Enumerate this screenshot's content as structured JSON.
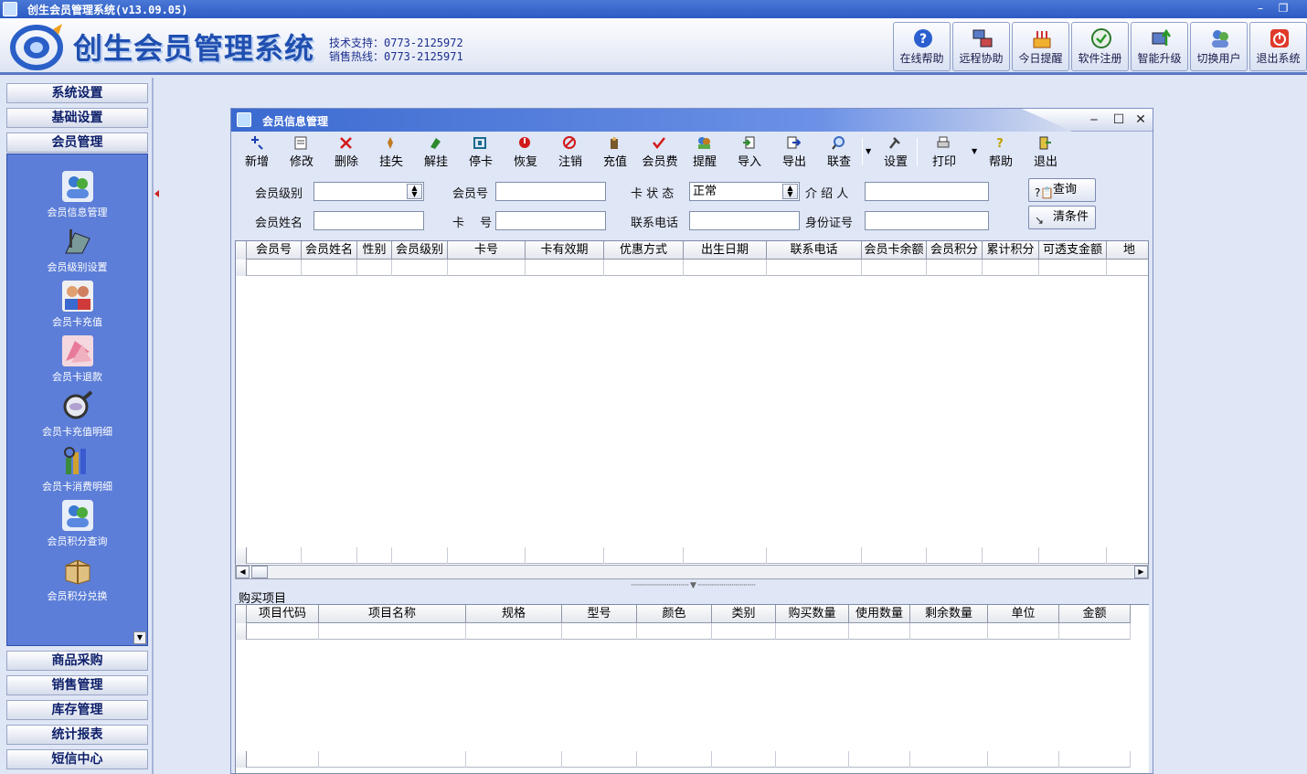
{
  "window": {
    "title": "创生会员管理系统(v13.09.05)",
    "min": "–",
    "restore": "❐",
    "close": "✕"
  },
  "header": {
    "brand": "创生会员管理系统",
    "support": "技术支持：0773-2125972",
    "hotline": "销售热线：0773-2125971",
    "buttons": [
      {
        "label": "在线帮助",
        "icon": "help-icon"
      },
      {
        "label": "远程协助",
        "icon": "remote-icon"
      },
      {
        "label": "今日提醒",
        "icon": "cake-icon"
      },
      {
        "label": "软件注册",
        "icon": "register-icon"
      },
      {
        "label": "智能升级",
        "icon": "upgrade-icon"
      },
      {
        "label": "切换用户",
        "icon": "user-switch-icon"
      },
      {
        "label": "退出系统",
        "icon": "power-icon"
      }
    ]
  },
  "sidebar": {
    "top_groups": [
      "系统设置",
      "基础设置",
      "会员管理"
    ],
    "items": [
      {
        "label": "会员信息管理",
        "icon": "members-icon"
      },
      {
        "label": "会员级别设置",
        "icon": "level-settings-icon"
      },
      {
        "label": "会员卡充值",
        "icon": "recharge-icon"
      },
      {
        "label": "会员卡退款",
        "icon": "refund-icon"
      },
      {
        "label": "会员卡充值明细",
        "icon": "magnifier-icon"
      },
      {
        "label": "会员卡消费明细",
        "icon": "consumption-icon"
      },
      {
        "label": "会员积分查询",
        "icon": "points-query-icon"
      },
      {
        "label": "会员积分兑换",
        "icon": "gift-box-icon"
      }
    ],
    "bottom_groups": [
      "商品采购",
      "销售管理",
      "库存管理",
      "统计报表",
      "短信中心"
    ]
  },
  "child": {
    "title": "会员信息管理",
    "toolbar": [
      {
        "label": "新增",
        "icon": "add-icon",
        "color": "#1a3fb0"
      },
      {
        "label": "修改",
        "icon": "edit-icon",
        "color": "#444444"
      },
      {
        "label": "删除",
        "icon": "delete-icon",
        "color": "#d21818"
      },
      {
        "label": "挂失",
        "icon": "report-loss-icon",
        "color": "#c07a20"
      },
      {
        "label": "解挂",
        "icon": "unlock-icon",
        "color": "#2c8a2c"
      },
      {
        "label": "停卡",
        "icon": "stop-card-icon",
        "color": "#1a6a8a"
      },
      {
        "label": "恢复",
        "icon": "restore-icon",
        "color": "#d21818"
      },
      {
        "label": "注销",
        "icon": "cancel-icon",
        "color": "#d21818"
      },
      {
        "label": "充值",
        "icon": "charge-icon",
        "color": "#7a5a2a"
      },
      {
        "label": "会员费",
        "icon": "check-icon",
        "color": "#d21818"
      },
      {
        "label": "提醒",
        "icon": "remind-icon",
        "color": "#c07a20"
      },
      {
        "label": "导入",
        "icon": "import-icon",
        "color": "#2c8a2c"
      },
      {
        "label": "导出",
        "icon": "export-icon",
        "color": "#1a3fb0"
      },
      {
        "label": "联查",
        "icon": "search-icon",
        "color": "#3a6ac0"
      },
      {
        "label": "设置",
        "icon": "settings-icon",
        "color": "#444444"
      },
      {
        "label": "打印",
        "icon": "print-icon",
        "color": "#444444"
      },
      {
        "label": "帮助",
        "icon": "help-icon",
        "color": "#c0a000"
      },
      {
        "label": "退出",
        "icon": "exit-icon",
        "color": "#2c8a2c"
      }
    ],
    "form": {
      "level_label": "会员级别",
      "member_no_label": "会员号",
      "card_status_label": "卡 状 态",
      "card_status_value": "正常",
      "referrer_label": "介 绍 人",
      "name_label": "会员姓名",
      "card_no_label": "卡　 号",
      "phone_label": "联系电话",
      "idcard_label": "身份证号",
      "query_btn": "查询",
      "clear_btn": "清条件"
    },
    "main_grid": {
      "columns": [
        "会员号",
        "会员姓名",
        "性别",
        "会员级别",
        "卡号",
        "卡有效期",
        "优惠方式",
        "出生日期",
        "联系电话",
        "会员卡余额",
        "会员积分",
        "累计积分",
        "可透支金额",
        "地"
      ]
    },
    "purchase": {
      "label": "购买项目",
      "columns": [
        "项目代码",
        "项目名称",
        "规格",
        "型号",
        "颜色",
        "类别",
        "购买数量",
        "使用数量",
        "剩余数量",
        "单位",
        "金额"
      ]
    }
  }
}
